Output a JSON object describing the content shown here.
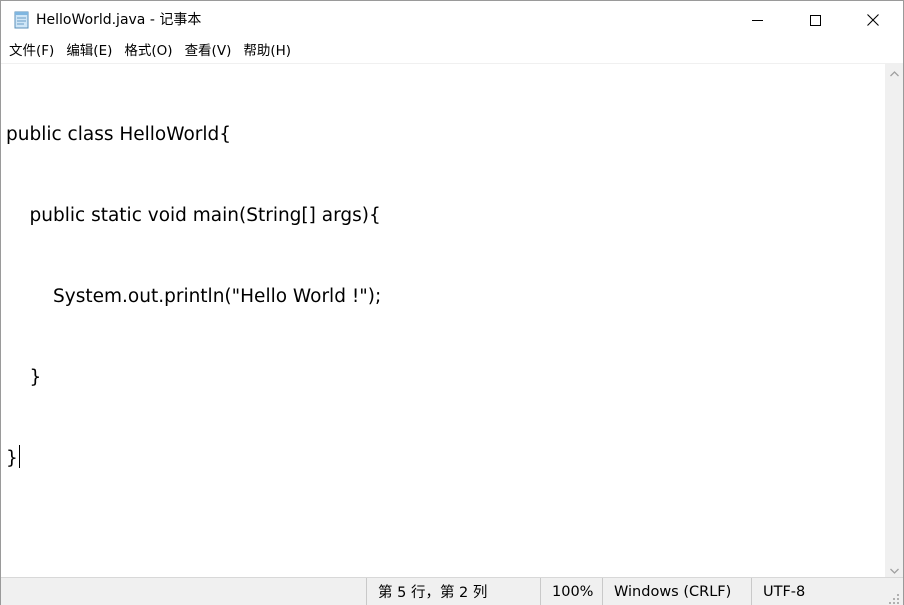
{
  "window": {
    "title": "HelloWorld.java - 记事本",
    "icon": "notepad-icon",
    "controls": {
      "minimize": "minimize-icon",
      "maximize": "maximize-icon",
      "close": "close-icon"
    }
  },
  "menubar": {
    "items": [
      {
        "label": "文件(F)"
      },
      {
        "label": "编辑(E)"
      },
      {
        "label": "格式(O)"
      },
      {
        "label": "查看(V)"
      },
      {
        "label": "帮助(H)"
      }
    ]
  },
  "editor": {
    "lines": [
      "public class HelloWorld{",
      "    public static void main(String[] args){",
      "        System.out.println(\"Hello World !\");",
      "    }",
      "}"
    ]
  },
  "statusbar": {
    "position": "第 5 行，第 2 列",
    "zoom": "100%",
    "line_ending": "Windows (CRLF)",
    "encoding": "UTF-8"
  },
  "colors": {
    "background": "#ffffff",
    "chrome": "#f0f0f0",
    "text": "#000000"
  }
}
